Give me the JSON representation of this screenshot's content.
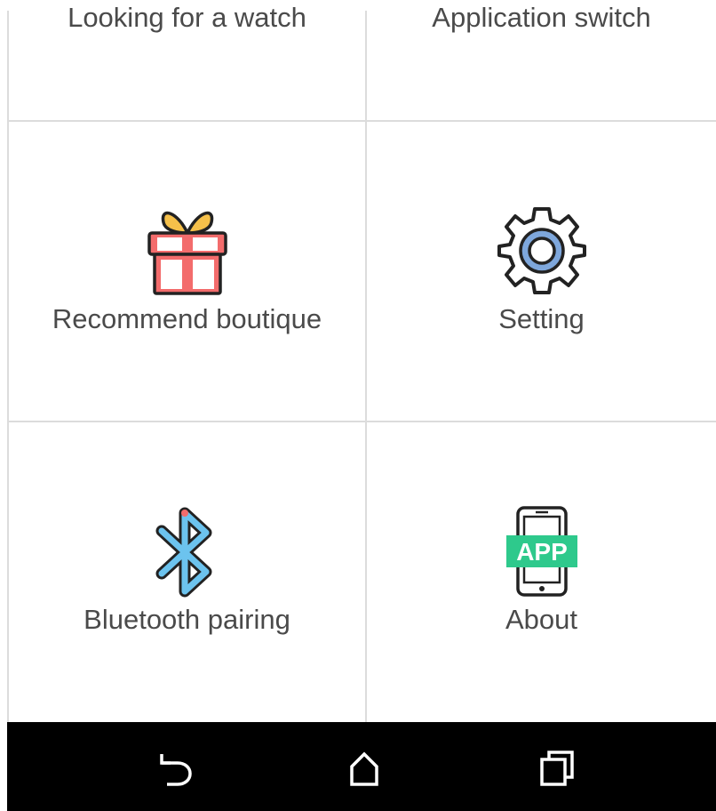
{
  "grid": {
    "items": [
      {
        "label": "Looking for a watch",
        "icon": "watch-icon"
      },
      {
        "label": "Application switch",
        "icon": "switch-icon"
      },
      {
        "label": "Recommend boutique",
        "icon": "gift-icon"
      },
      {
        "label": "Setting",
        "icon": "gear-icon"
      },
      {
        "label": "Bluetooth pairing",
        "icon": "bluetooth-icon"
      },
      {
        "label": "About",
        "icon": "phone-app-icon",
        "icon_text": "APP"
      }
    ]
  },
  "navbar": {
    "buttons": [
      "back-icon",
      "home-icon",
      "recents-icon"
    ]
  },
  "colors": {
    "gift_red": "#f36c6c",
    "gift_bow": "#f5c04a",
    "gear_ring": "#7ea7dc",
    "bluetooth_blue": "#6cc3ee",
    "app_green": "#2ec98c",
    "label_text": "#4a4a4a",
    "divider": "#dcdcdc"
  }
}
